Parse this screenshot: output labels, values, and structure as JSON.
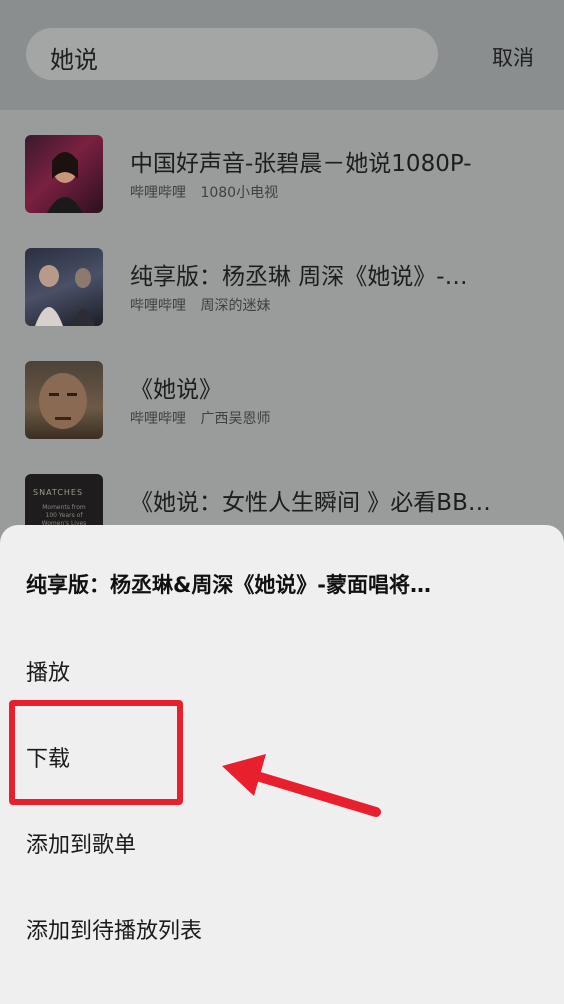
{
  "search": {
    "query": "她说",
    "cancel_label": "取消"
  },
  "results": [
    {
      "title": "中国好声音-张碧晨－她说1080P-",
      "platform": "哔哩哔哩",
      "uploader": "1080小电视"
    },
    {
      "title": "纯享版：杨丞琳 周深《她说》-…",
      "platform": "哔哩哔哩",
      "uploader": "周深的迷妹"
    },
    {
      "title": "《她说》",
      "platform": "哔哩哔哩",
      "uploader": "广西吴恩师"
    },
    {
      "title": "《她说：女性人生瞬间 》必看BB…",
      "platform": "",
      "uploader": ""
    }
  ],
  "thumb4_text": {
    "line1": "SNATCHES",
    "line2": "Moments from 100 Years of Women's Lives"
  },
  "sheet": {
    "title": "纯享版：杨丞琳&周深《她说》-蒙面唱将…",
    "options": [
      "播放",
      "下载",
      "添加到歌单",
      "添加到待播放列表"
    ]
  },
  "annotation": {
    "color": "#e8202e",
    "highlighted_option": "下载"
  }
}
